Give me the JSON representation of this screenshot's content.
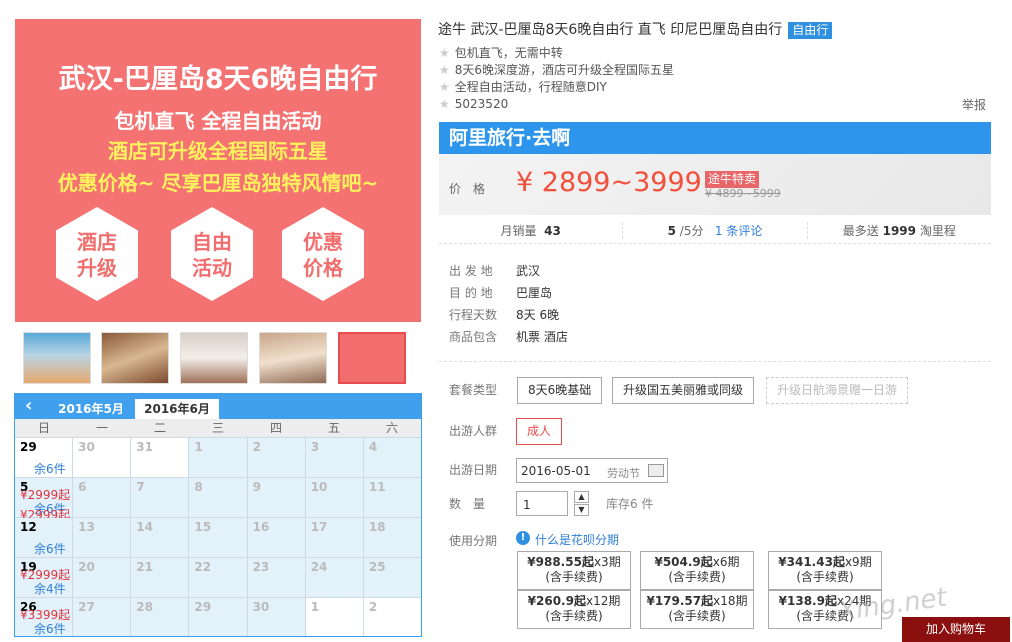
{
  "banner": {
    "title": "武汉-巴厘岛8天6晚自由行",
    "line1": "包机直飞 全程自由活动",
    "line2": "酒店可升级全程国际五星",
    "line3": "优惠价格~ 尽享巴厘岛独特风情吧~",
    "hex": [
      [
        "酒店",
        "升级"
      ],
      [
        "自由",
        "活动"
      ],
      [
        "优惠",
        "价格"
      ]
    ]
  },
  "calendar": {
    "prev": "‹",
    "months": [
      "2016年5月",
      "2016年6月"
    ],
    "dow": [
      "日",
      "一",
      "二",
      "三",
      "四",
      "五",
      "六"
    ],
    "weeks": [
      [
        {
          "d": "29",
          "k": true,
          "s": "余6件"
        },
        {
          "d": "30"
        },
        {
          "d": "31"
        },
        {
          "d": "1",
          "b": true
        },
        {
          "d": "2",
          "b": true
        },
        {
          "d": "3",
          "b": true
        },
        {
          "d": "4",
          "b": true
        }
      ],
      [
        {
          "d": "5",
          "k": true,
          "p": "¥2999起",
          "s": "余6件",
          "p2": "¥2999起",
          "b": true
        },
        {
          "d": "6",
          "b": true
        },
        {
          "d": "7",
          "b": true
        },
        {
          "d": "8",
          "b": true
        },
        {
          "d": "9",
          "b": true
        },
        {
          "d": "10",
          "b": true
        },
        {
          "d": "11",
          "b": true
        }
      ],
      [
        {
          "d": "12",
          "k": true,
          "s": "余6件",
          "b": true
        },
        {
          "d": "13",
          "b": true
        },
        {
          "d": "14",
          "b": true
        },
        {
          "d": "15",
          "b": true
        },
        {
          "d": "16",
          "b": true
        },
        {
          "d": "17",
          "b": true
        },
        {
          "d": "18",
          "b": true
        }
      ],
      [
        {
          "d": "19",
          "k": true,
          "p": "¥2999起",
          "s": "余4件",
          "b": true
        },
        {
          "d": "20",
          "b": true
        },
        {
          "d": "21",
          "b": true
        },
        {
          "d": "22",
          "b": true
        },
        {
          "d": "23",
          "b": true
        },
        {
          "d": "24",
          "b": true
        },
        {
          "d": "25",
          "b": true
        }
      ],
      [
        {
          "d": "26",
          "k": true,
          "p": "¥3399起",
          "s": "余6件",
          "b": true
        },
        {
          "d": "27",
          "b": true
        },
        {
          "d": "28",
          "b": true
        },
        {
          "d": "29",
          "b": true
        },
        {
          "d": "30",
          "b": true
        },
        {
          "d": "1"
        },
        {
          "d": "2"
        }
      ]
    ]
  },
  "product": {
    "title": "途牛 武汉-巴厘岛8天6晚自由行 直飞 印尼巴厘岛自由行",
    "badge": "自由行",
    "features": [
      "包机直飞，无需中转",
      "8天6晚深度游，酒店可升级全程国际五星",
      "全程自由活动，行程随意DIY",
      "5023520"
    ],
    "report": "举报"
  },
  "ali": {
    "logo": "阿里旅行·去啊",
    "price_label": "价　格",
    "price": "¥ 2899~3999",
    "tag": "途牛特卖",
    "old_price": "¥ 4899~5999"
  },
  "sales": {
    "monthly_label": "月销量",
    "monthly": "43",
    "score": "5",
    "score_suffix": "/5分",
    "reviews": "1 条评论",
    "points_prefix": "最多送",
    "points": "1999",
    "points_suffix": "淘里程"
  },
  "info": [
    {
      "label": "出 发 地",
      "value": "武汉"
    },
    {
      "label": "目 的 地",
      "value": "巴厘岛"
    },
    {
      "label": "行程天数",
      "value": "8天 6晚"
    },
    {
      "label": "商品包含",
      "value": "机票 酒店"
    }
  ],
  "options": {
    "package_label": "套餐类型",
    "packages": [
      "8天6晚基础",
      "升级国五美丽雅或同级",
      "升级日航海景赠一日游"
    ],
    "crowd_label": "出游人群",
    "crowd": "成人",
    "date_label": "出游日期",
    "date": "2016-05-01",
    "holiday": "劳动节",
    "qty_label": "数　量",
    "qty": "1",
    "stock": "库存6 件",
    "installment_label": "使用分期",
    "installment_help": "什么是花呗分期",
    "installments": [
      [
        "¥988.55起",
        "x3期"
      ],
      [
        "¥504.9起",
        "x6期"
      ],
      [
        "¥341.43起",
        "x9期"
      ],
      [
        "¥260.9起",
        "x12期"
      ],
      [
        "¥179.57起",
        "x18期"
      ],
      [
        "¥138.9起",
        "x24期"
      ]
    ],
    "fee_note": "(含手续费)"
  },
  "cart": "加入购物车",
  "watermark": "Xing.net"
}
